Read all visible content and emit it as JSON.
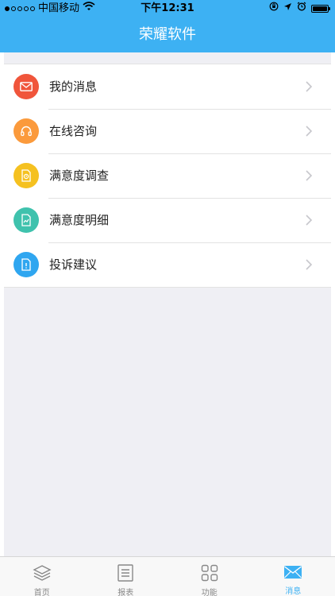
{
  "status_bar": {
    "carrier": "中国移动",
    "time": "下午12:31"
  },
  "header": {
    "title": "荣耀软件"
  },
  "menu": {
    "items": [
      {
        "label": "我的消息",
        "icon": "mail-icon",
        "color": "#f0553b"
      },
      {
        "label": "在线咨询",
        "icon": "headphones-icon",
        "color": "#fb9a3c"
      },
      {
        "label": "满意度调查",
        "icon": "survey-doc-icon",
        "color": "#f5c120"
      },
      {
        "label": "满意度明细",
        "icon": "chart-doc-icon",
        "color": "#3fc2ad"
      },
      {
        "label": "投诉建议",
        "icon": "complaint-doc-icon",
        "color": "#2fa6f0"
      }
    ]
  },
  "tabbar": {
    "tabs": [
      {
        "label": "首页",
        "icon": "layers-icon",
        "active": false
      },
      {
        "label": "报表",
        "icon": "list-doc-icon",
        "active": false
      },
      {
        "label": "功能",
        "icon": "grid-icon",
        "active": false
      },
      {
        "label": "消息",
        "icon": "envelope-icon",
        "active": true
      }
    ],
    "active_color": "#3db1f3",
    "inactive_color": "#888888"
  },
  "colors": {
    "header_bg": "#3db1f3",
    "content_bg": "#efeff4"
  }
}
